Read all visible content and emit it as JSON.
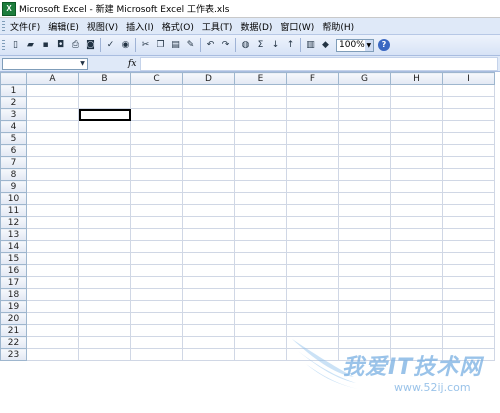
{
  "window": {
    "title": "Microsoft Excel - 新建 Microsoft Excel 工作表.xls",
    "icon": "excel-icon"
  },
  "menu": {
    "items": [
      "文件(F)",
      "编辑(E)",
      "视图(V)",
      "插入(I)",
      "格式(O)",
      "工具(T)",
      "数据(D)",
      "窗口(W)",
      "帮助(H)"
    ]
  },
  "toolbar": {
    "icons": [
      "new-icon",
      "open-icon",
      "save-icon",
      "permission-icon",
      "print-icon",
      "print-preview-icon",
      "spelling-icon",
      "research-icon",
      "cut-icon",
      "copy-icon",
      "paste-icon",
      "format-painter-icon",
      "undo-icon",
      "redo-icon",
      "hyperlink-icon",
      "autosum-icon",
      "sort-ascending-icon",
      "sort-descending-icon",
      "chart-wizard-icon",
      "drawing-icon"
    ],
    "sum_symbol": "Σ",
    "zoom": "100%",
    "help_symbol": "?"
  },
  "formula_bar": {
    "name_box": "",
    "fx_label": "fx",
    "formula": ""
  },
  "sheet": {
    "columns": [
      "A",
      "B",
      "C",
      "D",
      "E",
      "F",
      "G",
      "H",
      "I"
    ],
    "rows": [
      "1",
      "2",
      "3",
      "4",
      "5",
      "6",
      "7",
      "8",
      "9",
      "10",
      "11",
      "12",
      "13",
      "14",
      "15",
      "16",
      "17",
      "18",
      "19",
      "20",
      "21",
      "22",
      "23"
    ],
    "active_cell": "B3",
    "active_col": "B",
    "active_row": "3",
    "header_highlight_color": "#f3ba59"
  },
  "watermark": {
    "text": "我爱IT技术网",
    "url": "www.52ij.com"
  }
}
